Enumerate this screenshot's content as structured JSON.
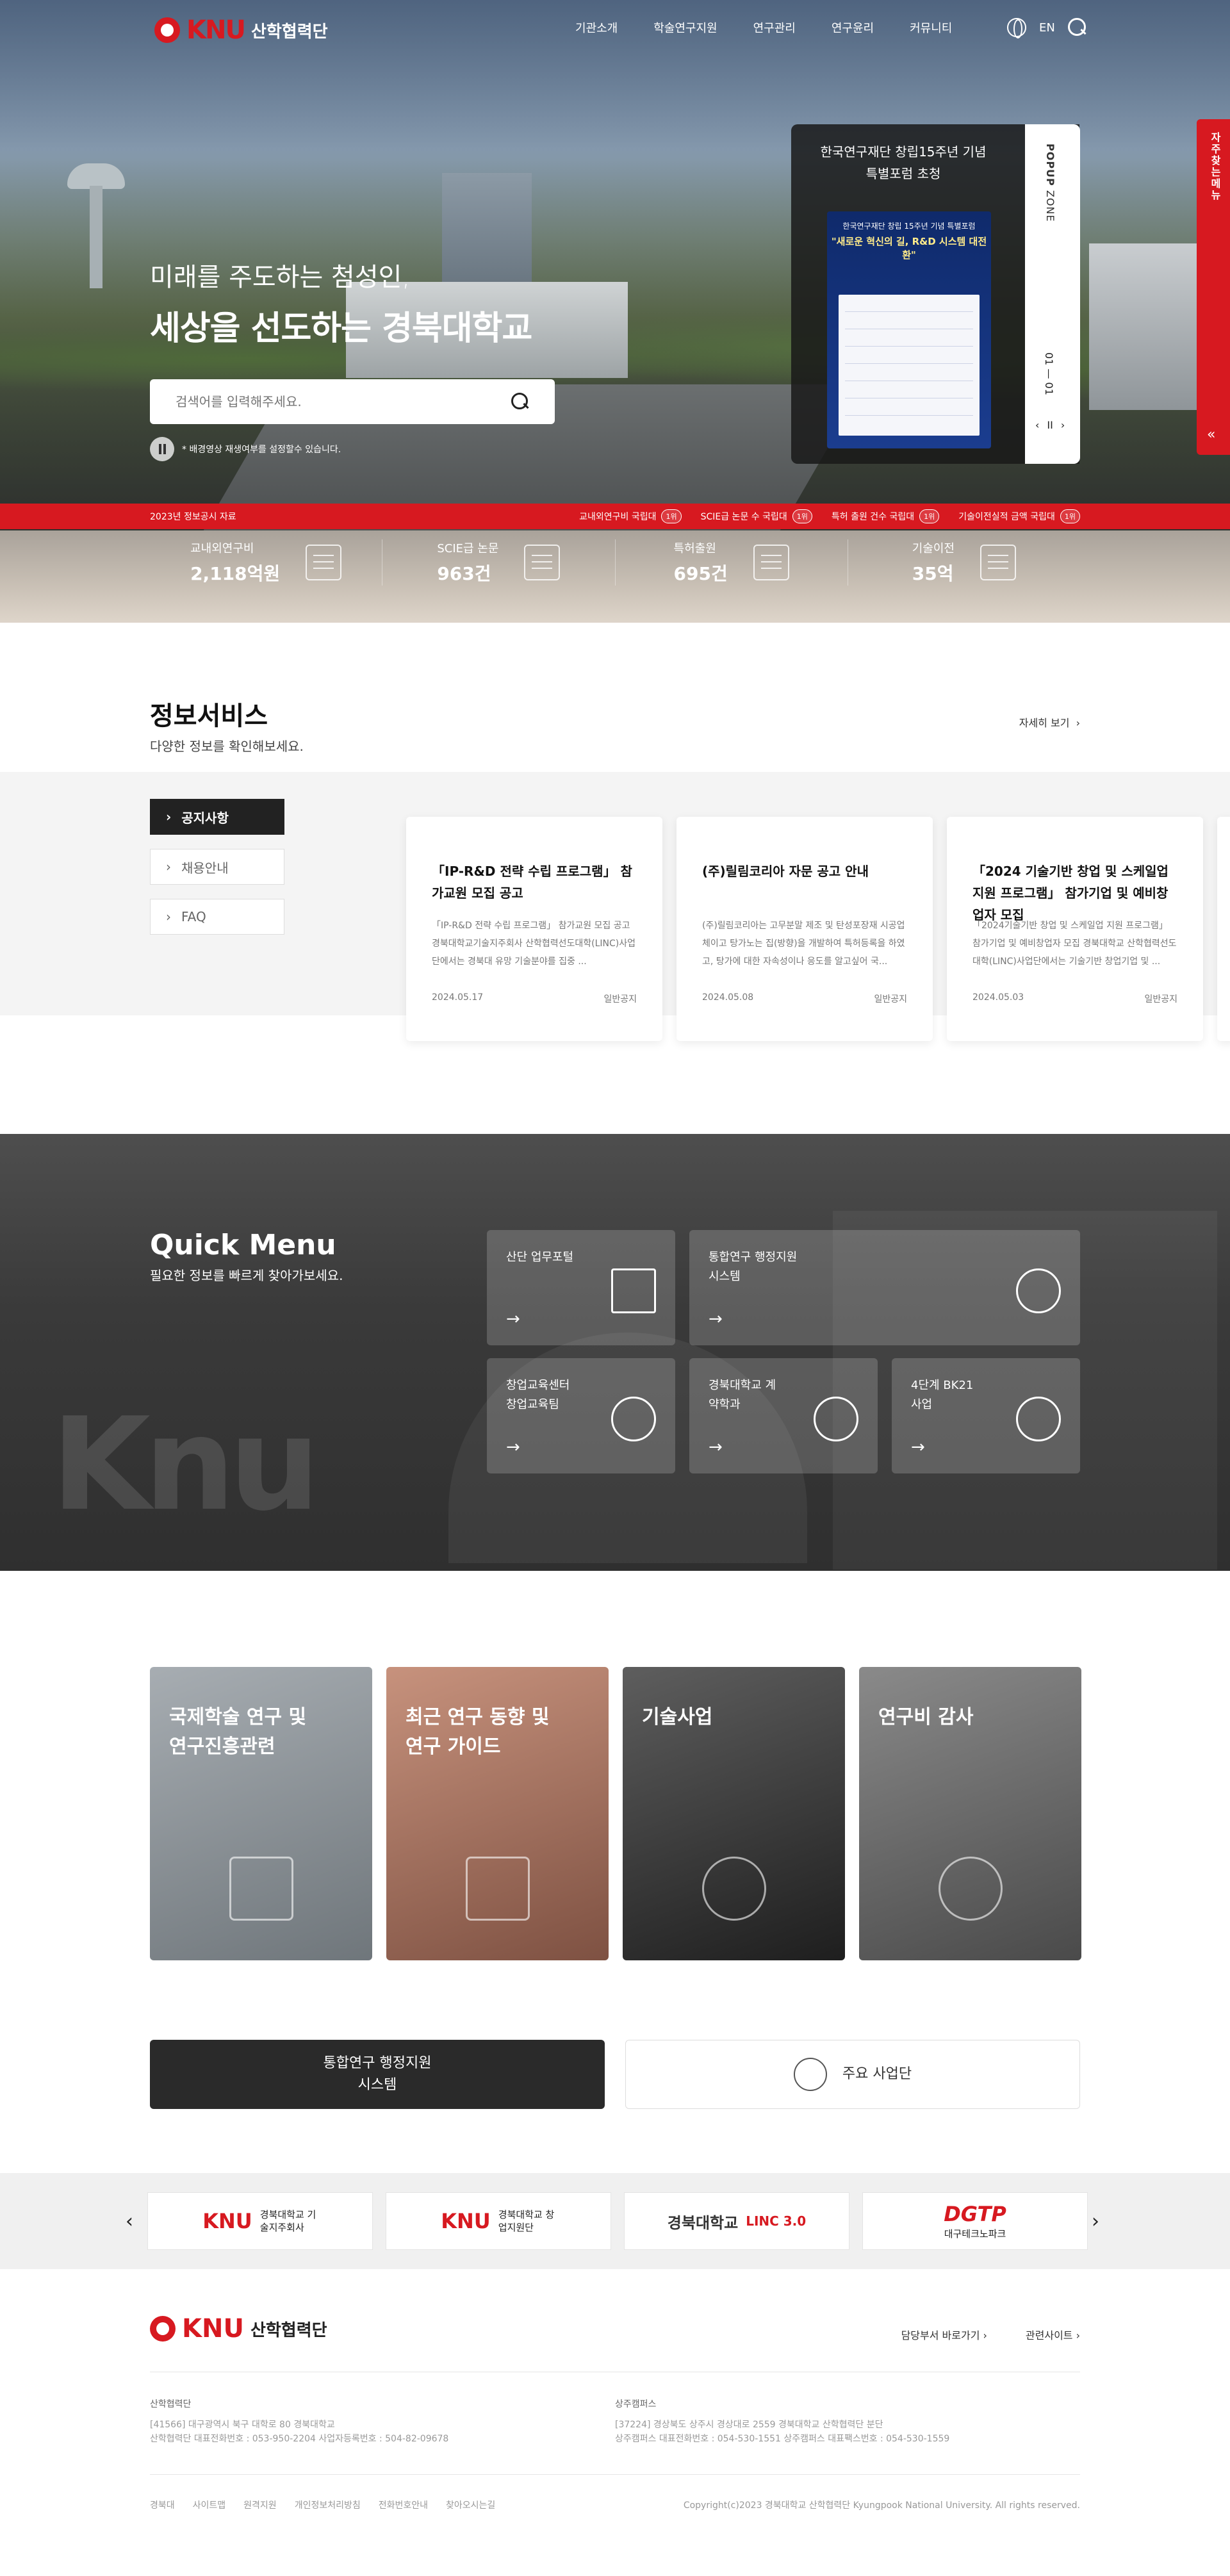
{
  "header": {
    "logo_text": "KNU",
    "logo_sub": "산학협력단",
    "nav": [
      "기관소개",
      "학술연구지원",
      "연구관리",
      "연구윤리",
      "커뮤니티"
    ],
    "lang": "EN"
  },
  "hero": {
    "line1": "미래를 주도하는 첨성인,",
    "line2": "세상을 선도하는 경북대학교",
    "search_placeholder": "검색어를 입력해주세요.",
    "notice": "* 배경영상 재생여부를 설정할수 있습니다."
  },
  "popup": {
    "title": "한국연구재단 창립15주년 기념 특별포럼 초청",
    "poster_head": "한국연구재단 창립 15주년 기념 특별포럼",
    "poster_title": "\"새로운 혁신의 길, R&D 시스템 대전환\"",
    "zone_label": "POPUP",
    "zone_sub": "ZONE",
    "counter": "01 — 01",
    "controls": [
      "‹",
      "II",
      "›"
    ]
  },
  "quick_side": {
    "label": "자주찾는메뉴",
    "toggle": "«"
  },
  "redbar": {
    "source": "2023년 정보공시 자료",
    "tags": [
      {
        "text": "교내외연구비 국립대",
        "badge": "1위"
      },
      {
        "text": "SCIE급 논문 수 국립대",
        "badge": "1위"
      },
      {
        "text": "특허 출원 건수 국립대",
        "badge": "1위"
      },
      {
        "text": "기술이전실적 금액 국립대",
        "badge": "1위"
      }
    ]
  },
  "stats": [
    {
      "label": "교내외연구비",
      "value": "2,118억원"
    },
    {
      "label": "SCIE급 논문",
      "value": "963건"
    },
    {
      "label": "특허출원",
      "value": "695건"
    },
    {
      "label": "기술이전",
      "value": "35억"
    }
  ],
  "info": {
    "title": "정보서비스",
    "subtitle": "다양한 정보를 확인해보세요.",
    "more": "자세히 보기",
    "tabs": [
      "공지사항",
      "채용안내",
      "FAQ"
    ],
    "cards": [
      {
        "title": "「IP-R&D 전략 수립 프로그램」 참가교원 모집 공고",
        "body": "「IP-R&D 전략 수립 프로그램」 참가교원 모집 공고 경북대학교기술지주회사 산학협력선도대학(LINC)사업단에서는 경북대 유망 기술분야를 집중 ...",
        "date": "2024.05.17",
        "type": "일반공지"
      },
      {
        "title": "(주)릴림코리아 자문 공고 안내",
        "body": "(주)릴림코리아는 고무분말 제조 및 탄성포장재 시공업체이고 탕가노는 집(방향)을 개발하여 특허등록을 하였고, 탕가에 대한 자속성이나 응도를 알고싶어 국...",
        "date": "2024.05.08",
        "type": "일반공지"
      },
      {
        "title": "「2024 기술기반 창업 및 스케일업 지원 프로그램」 참가기업 및 예비창업자 모집",
        "body": "「2024기술기반 창업 및 스케일업 지원 프로그램」 참가기업 및 예비창업자 모집 경북대학교 산학협력선도대학(LINC)사업단에서는 기술기반 창업기업 및 ...",
        "date": "2024.05.03",
        "type": "일반공지"
      }
    ]
  },
  "quick_menu": {
    "title": "Quick Menu",
    "subtitle": "필요한 정보를 빠르게 찾아가보세요.",
    "bg_text": "Knu",
    "items": [
      {
        "label": "산단 업무포털",
        "icon": "news-icon"
      },
      {
        "label": "통합연구 행정지원시스템",
        "icon": "atom-icon"
      },
      {
        "label": "창업교육센터 창업교육팀",
        "icon": "emblem-icon"
      },
      {
        "label": "경북대학교 계약학과",
        "icon": "emblem-icon"
      },
      {
        "label": "4단계 BK21사업",
        "icon": "bk21-icon"
      }
    ],
    "arrow": "→"
  },
  "banners": [
    {
      "title": "국제학술 연구 및 연구진흥관련",
      "color": "#8f969c"
    },
    {
      "title": "최근 연구 동향 및 연구 가이드",
      "color": "#b3755f"
    },
    {
      "title": "기술사업",
      "color": "#4a4a4a"
    },
    {
      "title": "연구비 감사",
      "color": "#6e6e6e"
    }
  ],
  "buttons": {
    "dark": "통합연구 행정지원시스템",
    "light": "주요 사업단"
  },
  "partners": [
    {
      "logo": "KNU",
      "name": "경북대학교 기술지주회사"
    },
    {
      "logo": "KNU",
      "name": "경북대학교 창업지원단"
    },
    {
      "logo": "경북대학교",
      "name": "LINC 3.0"
    },
    {
      "logo": "DGTP",
      "name": "대구테크노파크"
    }
  ],
  "footer": {
    "logo_text": "KNU",
    "logo_sub": "산학협력단",
    "links": [
      "담당부서 바로가기",
      "관련사이트"
    ],
    "address1": {
      "name": "산학협력단",
      "line1": "[41566] 대구광역시 북구 대학로 80 경북대학교",
      "line2": "산학협력단 대표전화번호 : 053-950-2204 사업자등록번호 : 504-82-09678"
    },
    "address2": {
      "name": "상주캠퍼스",
      "line1": "[37224] 경상북도 상주시 경상대로 2559 경북대학교 산학협력단 분단",
      "line2": "상주캠퍼스 대표전화번호 : 054-530-1551 상주캠퍼스 대표팩스번호 : 054-530-1559"
    },
    "bottom_links": [
      "경북대",
      "사이트맵",
      "원격지원",
      "개인정보처리방침",
      "전화번호안내",
      "찾아오시는길"
    ],
    "copyright": "Copyright(c)2023 경북대학교 산학협력단 Kyungpook National University. All rights reserved."
  }
}
